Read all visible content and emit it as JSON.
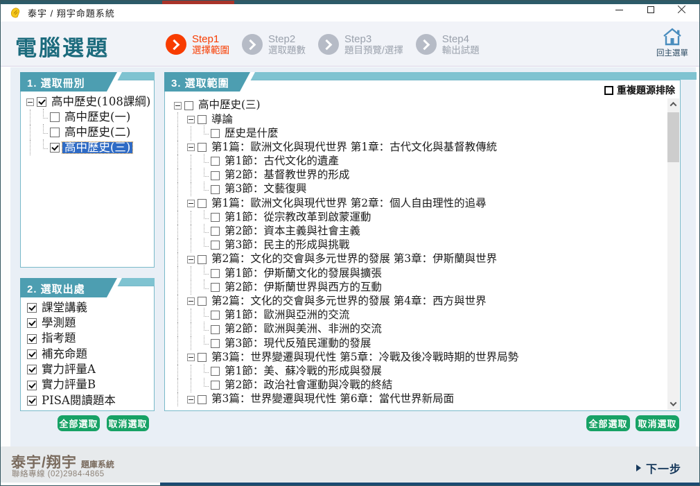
{
  "window": {
    "title": "泰宇 / 翔宇命題系統"
  },
  "icons": {
    "app": "yellow-hand-pen-logo",
    "minimize": "minimize-line",
    "maximize": "maximize-square",
    "close": "close-x",
    "step": "chevron-right-in-circle",
    "home": "house-outline",
    "next": "triangle-right",
    "tree_expand": "minus-box",
    "scrollbar": "chevron-up-down"
  },
  "header": {
    "page_title": "電腦選題",
    "home_label": "回主選單",
    "steps": [
      {
        "num": "Step1",
        "label": "選擇範圍",
        "active": true
      },
      {
        "num": "Step2",
        "label": "選取題數",
        "active": false
      },
      {
        "num": "Step3",
        "label": "題目預覽/選擇",
        "active": false
      },
      {
        "num": "Step4",
        "label": "輸出試題",
        "active": false
      }
    ]
  },
  "panel_volumes": {
    "title": "1. 選取冊別",
    "tree": [
      {
        "level": 0,
        "expand": true,
        "checked": true,
        "selected": false,
        "label": "高中歷史(108課綱)"
      },
      {
        "level": 1,
        "expand": false,
        "checked": false,
        "selected": false,
        "label": "高中歷史(一)"
      },
      {
        "level": 1,
        "expand": false,
        "checked": false,
        "selected": false,
        "label": "高中歷史(二)"
      },
      {
        "level": 1,
        "expand": false,
        "checked": true,
        "selected": true,
        "label": "高中歷史(三)"
      }
    ]
  },
  "panel_sources": {
    "title": "2. 選取出處",
    "items": [
      {
        "checked": true,
        "label": "課堂講義"
      },
      {
        "checked": true,
        "label": "學測題"
      },
      {
        "checked": true,
        "label": "指考題"
      },
      {
        "checked": true,
        "label": "補充命題"
      },
      {
        "checked": true,
        "label": "實力評量A"
      },
      {
        "checked": true,
        "label": "實力評量B"
      },
      {
        "checked": true,
        "label": "PISA閱讀題本"
      }
    ],
    "buttons": {
      "select_all": "全部選取",
      "deselect_all": "取消選取"
    }
  },
  "panel_range": {
    "title": "3. 選取範圍",
    "dedupe": {
      "label": "重複題源排除",
      "checked": false
    },
    "buttons": {
      "select_all": "全部選取",
      "deselect_all": "取消選取"
    },
    "tree": [
      {
        "level": 0,
        "expand": true,
        "checked": false,
        "label": "高中歷史(三)"
      },
      {
        "level": 1,
        "expand": true,
        "checked": false,
        "label": "導論"
      },
      {
        "level": 2,
        "expand": false,
        "checked": false,
        "label": "歷史是什麼"
      },
      {
        "level": 1,
        "expand": true,
        "checked": false,
        "label": "第1篇：歐洲文化與現代世界 第1章：古代文化與基督教傳統"
      },
      {
        "level": 2,
        "expand": false,
        "checked": false,
        "label": "第1節：古代文化的遺產"
      },
      {
        "level": 2,
        "expand": false,
        "checked": false,
        "label": "第2節：基督教世界的形成"
      },
      {
        "level": 2,
        "expand": false,
        "checked": false,
        "label": "第3節：文藝復興"
      },
      {
        "level": 1,
        "expand": true,
        "checked": false,
        "label": "第1篇：歐洲文化與現代世界 第2章：個人自由理性的追尋"
      },
      {
        "level": 2,
        "expand": false,
        "checked": false,
        "label": "第1節：從宗教改革到啟蒙運動"
      },
      {
        "level": 2,
        "expand": false,
        "checked": false,
        "label": "第2節：資本主義與社會主義"
      },
      {
        "level": 2,
        "expand": false,
        "checked": false,
        "label": "第3節：民主的形成與挑戰"
      },
      {
        "level": 1,
        "expand": true,
        "checked": false,
        "label": "第2篇：文化的交會與多元世界的發展 第3章：伊斯蘭與世界"
      },
      {
        "level": 2,
        "expand": false,
        "checked": false,
        "label": "第1節：伊斯蘭文化的發展與擴張"
      },
      {
        "level": 2,
        "expand": false,
        "checked": false,
        "label": "第2節：伊斯蘭世界與西方的互動"
      },
      {
        "level": 1,
        "expand": true,
        "checked": false,
        "label": "第2篇：文化的交會與多元世界的發展 第4章：西方與世界"
      },
      {
        "level": 2,
        "expand": false,
        "checked": false,
        "label": "第1節：歐洲與亞洲的交流"
      },
      {
        "level": 2,
        "expand": false,
        "checked": false,
        "label": "第2節：歐洲與美洲、非洲的交流"
      },
      {
        "level": 2,
        "expand": false,
        "checked": false,
        "label": "第3節：現代反殖民運動的發展"
      },
      {
        "level": 1,
        "expand": true,
        "checked": false,
        "label": "第3篇：世界變遷與現代性 第5章：冷戰及後冷戰時期的世界局勢"
      },
      {
        "level": 2,
        "expand": false,
        "checked": false,
        "label": "第1節：美、蘇冷戰的形成與發展"
      },
      {
        "level": 2,
        "expand": false,
        "checked": false,
        "label": "第2節：政治社會運動與冷戰的終結"
      },
      {
        "level": 1,
        "expand": true,
        "checked": false,
        "label": "第3篇：世界變遷與現代性 第6章：當代世界新局面"
      }
    ]
  },
  "footer": {
    "brand_main": "泰宇/翔宇",
    "brand_sub": "題庫系統",
    "contact": "聯絡專線 (02)2984-4865",
    "next_label": "下一步"
  },
  "colors": {
    "tab_teal_dark": "#4d9eb1",
    "strip_teal_light": "#7fc3d1",
    "panel_border": "#78b9c9",
    "step_active": "#f83c00",
    "step_inactive": "#b6bbc6",
    "button_green": "#17a265",
    "selection_blue": "#2f6bc5",
    "page_title_teal": "#1c6b7d",
    "footer_brand": "#7a6b5e",
    "edge_navy": "#1b4a71"
  }
}
